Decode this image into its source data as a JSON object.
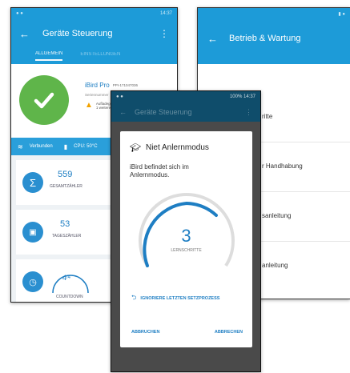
{
  "colors": {
    "primary": "#1d9bd8",
    "accent": "#5fb54a",
    "dialog_accent": "#1e7ec3"
  },
  "phone1": {
    "status_time": "14:37",
    "toolbar_title": "Geräte Steuerung",
    "tabs": [
      "ALLGEMEIN",
      "EINSTELLUNGEN"
    ],
    "device": {
      "name": "iBird Pro",
      "id": "PPI-171047036",
      "line2": "Seriennummer",
      "warn_line1": "Aufladegerät",
      "warn_line2": "1 weitere"
    },
    "status_bar": {
      "wifi_label": "Verbunden",
      "battery_label": "CPU: 50°C"
    },
    "stats": [
      {
        "value": "559",
        "label": "GESAMTZÄHLER"
      },
      {
        "value": "53",
        "label": "TAGESZÄHLER"
      },
      {
        "value": "4",
        "unit": "/4",
        "label": "COUNTDOWN"
      }
    ]
  },
  "phone2": {
    "toolbar_title": "Betrieb & Wartung",
    "items": [
      "ritte",
      "r Handhabung",
      "sanleitung",
      "anleitung"
    ]
  },
  "phone3": {
    "status_text": "100% 14:37",
    "dim_title": "Geräte Steuerung",
    "dialog": {
      "title": "Niet Anlernmodus",
      "message": "iBird befindet sich im Anlernmodus.",
      "count": "3",
      "count_label": "LERNSCHRITTE",
      "ignore_label": "IGNORIERE LETZTEN SETZPROZESS",
      "cancel_label": "ABBRUCHEN",
      "abort_label": "ABBRECHEN"
    }
  }
}
